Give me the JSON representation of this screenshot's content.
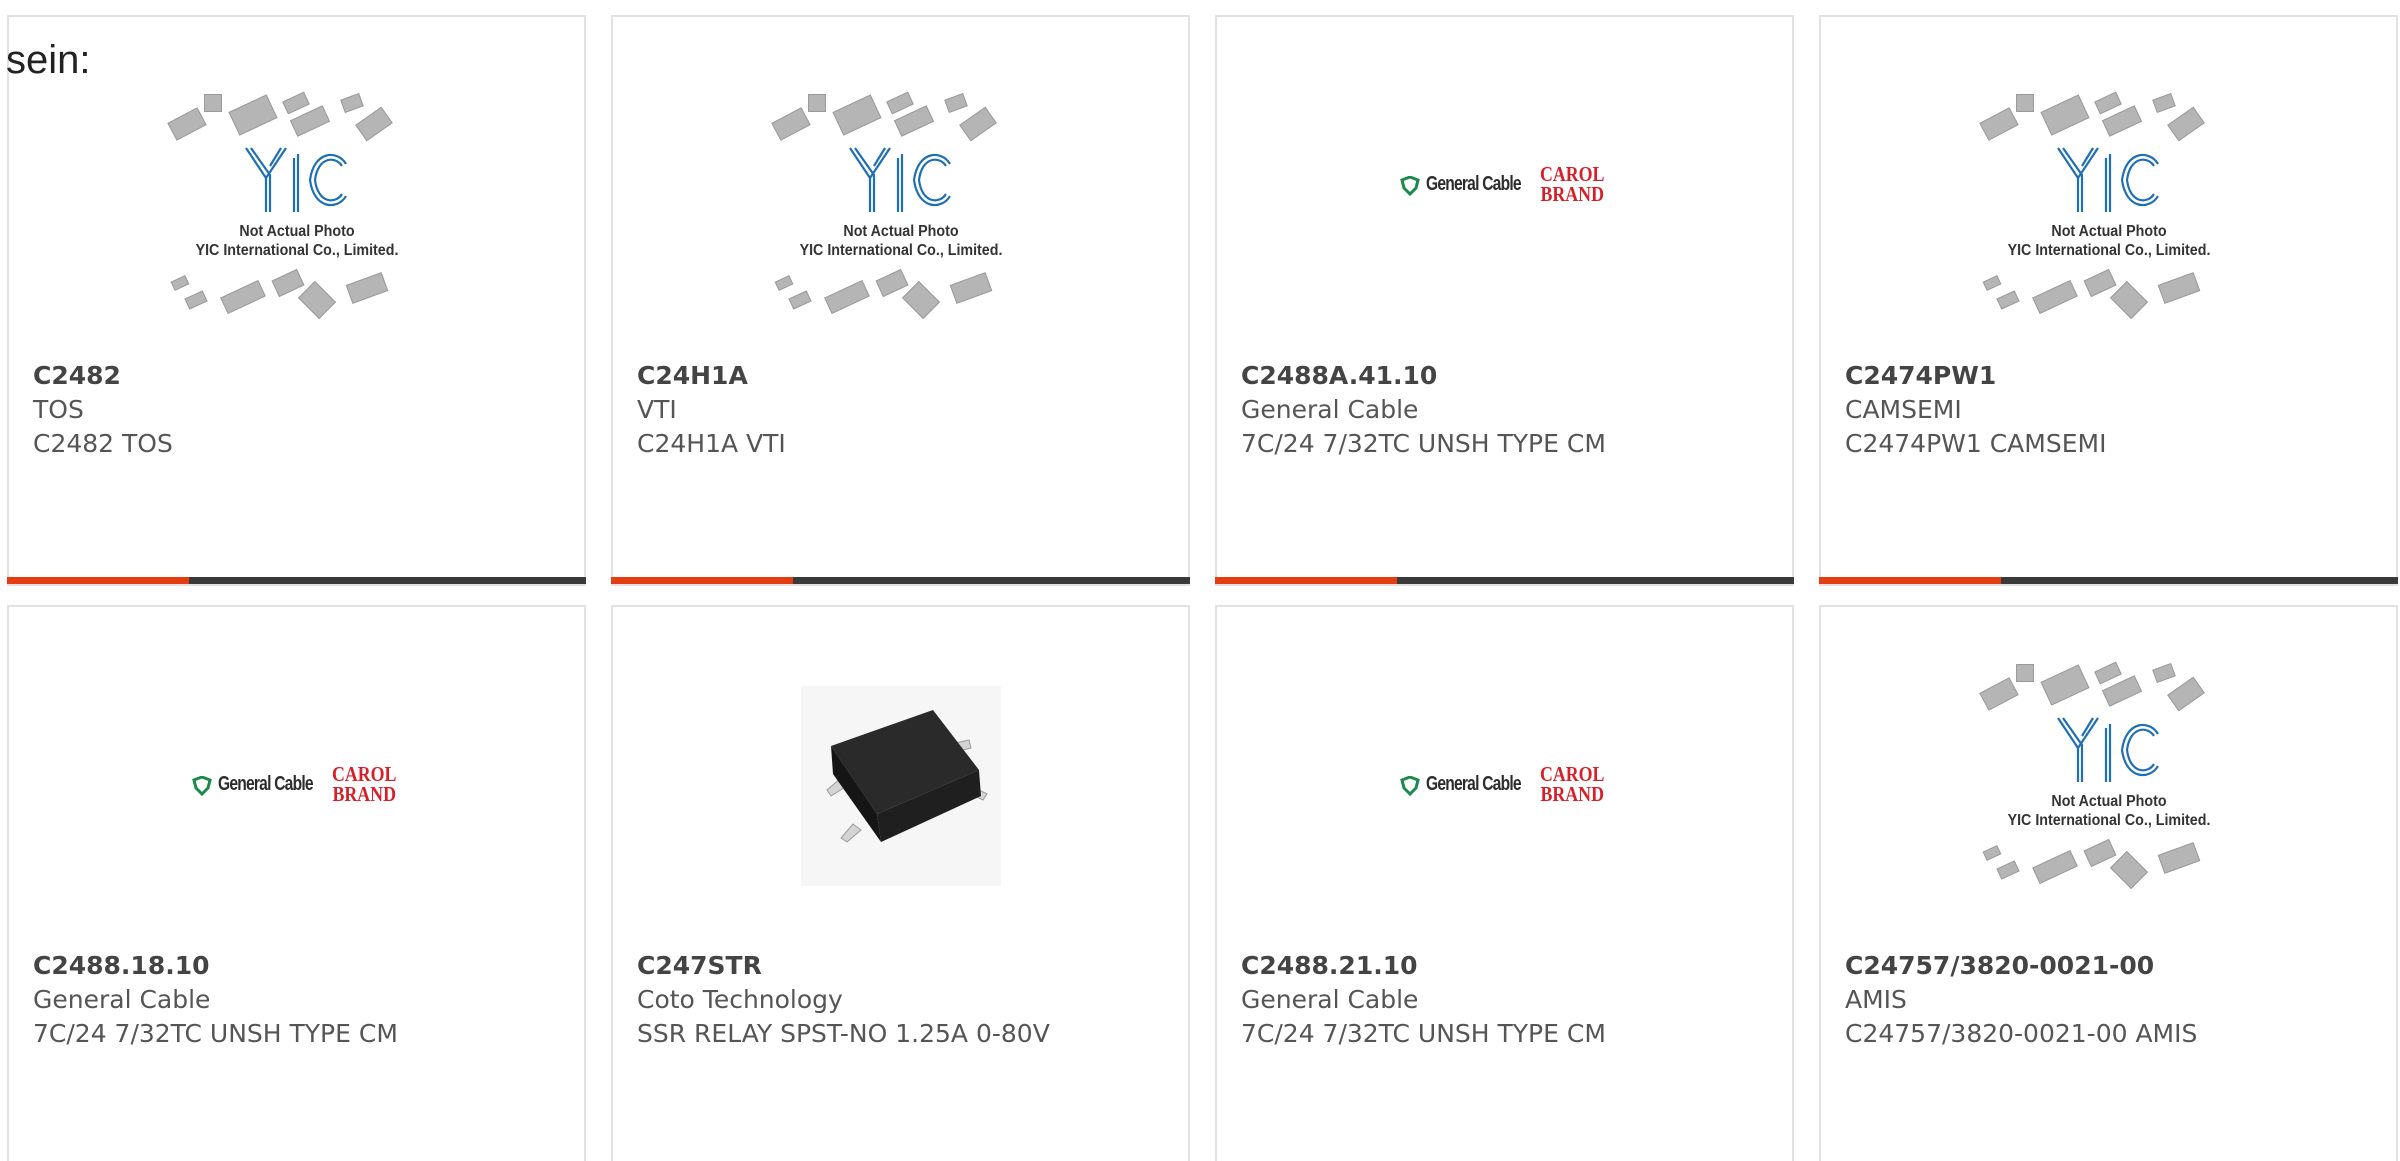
{
  "intro_text": "sein:",
  "placeholder_caption": {
    "line1": "Not Actual Photo",
    "line2": "YIC International Co., Limited."
  },
  "brand_logo": {
    "name": "General Cable",
    "carol_line1": "CAROL",
    "carol_line2": "BRAND"
  },
  "products": [
    {
      "part": "C2482",
      "maker": "TOS",
      "desc": "C2482 TOS",
      "image": "yic-placeholder"
    },
    {
      "part": "C24H1A",
      "maker": "VTI",
      "desc": "C24H1A VTI",
      "image": "yic-placeholder"
    },
    {
      "part": "C2488A.41.10",
      "maker": "General Cable",
      "desc": "7C/24 7/32TC UNSH TYPE CM",
      "image": "general-cable-logo"
    },
    {
      "part": "C2474PW1",
      "maker": "CAMSEMI",
      "desc": "C2474PW1 CAMSEMI",
      "image": "yic-placeholder"
    },
    {
      "part": "C2488.18.10",
      "maker": "General Cable",
      "desc": "7C/24 7/32TC UNSH TYPE CM",
      "image": "general-cable-logo"
    },
    {
      "part": "C247STR",
      "maker": "Coto Technology",
      "desc": "SSR RELAY SPST-NO 1.25A 0-80V",
      "image": "relay-photo"
    },
    {
      "part": "C2488.21.10",
      "maker": "General Cable",
      "desc": "7C/24 7/32TC UNSH TYPE CM",
      "image": "general-cable-logo"
    },
    {
      "part": "C24757/3820-0021-00",
      "maker": "AMIS",
      "desc": "C24757/3820-0021-00 AMIS",
      "image": "yic-placeholder"
    }
  ],
  "colors": {
    "accent": "#e43d12",
    "bar": "#3a3a3a",
    "yic_blue": "#1e6fb5",
    "carol_red": "#d8202a",
    "gc_green": "#1a8a4a"
  }
}
